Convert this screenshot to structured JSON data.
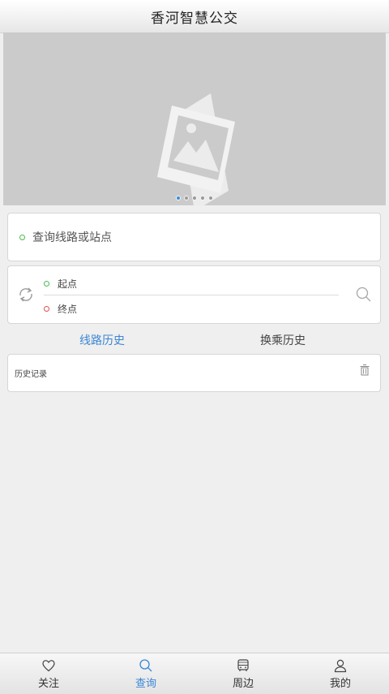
{
  "header": {
    "title": "香河智慧公交"
  },
  "banner": {
    "image_icon": "image-placeholder-icon",
    "slide_count": 5,
    "active_slide": 1
  },
  "search": {
    "placeholder": "查询线路或站点"
  },
  "route": {
    "start_label": "起点",
    "end_label": "终点"
  },
  "tabs": [
    {
      "label": "线路历史"
    },
    {
      "label": "换乘历史"
    }
  ],
  "history": {
    "label": "历史记录"
  },
  "bottom_nav": [
    {
      "label": "关注",
      "icon": "heart-icon"
    },
    {
      "label": "查询",
      "icon": "search-icon"
    },
    {
      "label": "周边",
      "icon": "bus-icon"
    },
    {
      "label": "我的",
      "icon": "user-icon"
    }
  ],
  "colors": {
    "accent": "#3b86d4",
    "start": "#4cba4c",
    "end": "#e35050",
    "banner_bg": "#cbcbcb"
  }
}
